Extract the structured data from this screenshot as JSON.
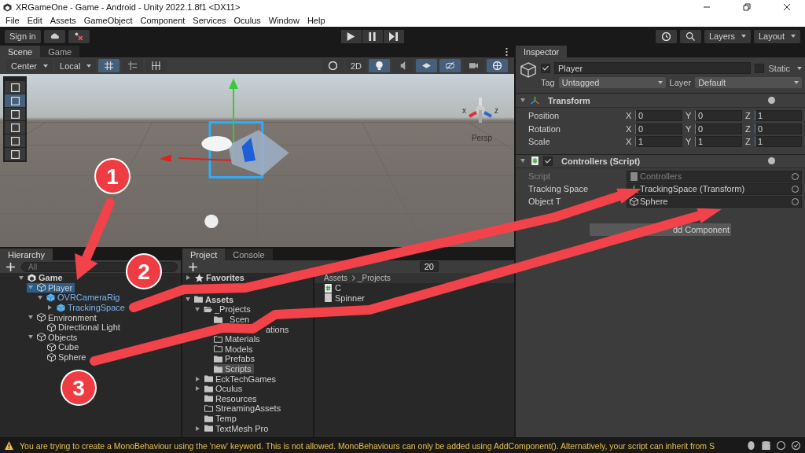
{
  "window": {
    "title": "XRGameOne - Game - Android - Unity 2022.1.8f1 <DX11>"
  },
  "menu": [
    "File",
    "Edit",
    "Assets",
    "GameObject",
    "Component",
    "Services",
    "Oculus",
    "Window",
    "Help"
  ],
  "toolbar": {
    "sign_in": "Sign in",
    "layers": "Layers",
    "layout": "Layout"
  },
  "scene_panel": {
    "tabs": [
      {
        "label": "Scene",
        "selected": true
      },
      {
        "label": "Game",
        "selected": false
      }
    ],
    "pivot": "Center",
    "space": "Local",
    "mode_2d": {
      "label": "2D",
      "selected": false
    },
    "lighting": {
      "selected": true
    },
    "gizmos": {
      "selected": true
    },
    "gizmo_labels": [
      "x",
      "z"
    ],
    "projection": "Persp"
  },
  "hierarchy": {
    "title": "Hierarchy",
    "search_placeholder": "All",
    "items": [
      {
        "label": "Game",
        "kind": "scene",
        "expanded": true,
        "selected": false,
        "children": [
          {
            "label": "Player",
            "kind": "object",
            "expanded": true,
            "selected": true,
            "children": [
              {
                "label": "OVRCameraRig",
                "kind": "prefab",
                "expanded": true,
                "selected": false,
                "children": [
                  {
                    "label": "TrackingSpace",
                    "kind": "prefab",
                    "expanded": false,
                    "selected": false
                  }
                ]
              }
            ]
          },
          {
            "label": "Environment",
            "kind": "object",
            "expanded": true,
            "selected": false,
            "children": [
              {
                "label": "Directional Light",
                "kind": "object",
                "selected": false
              }
            ]
          },
          {
            "label": "Objects",
            "kind": "object",
            "expanded": true,
            "selected": false,
            "children": [
              {
                "label": "Cube",
                "kind": "object",
                "selected": false
              },
              {
                "label": "Sphere",
                "kind": "object",
                "selected": false
              }
            ]
          }
        ]
      }
    ]
  },
  "project": {
    "tabs": [
      {
        "label": "Project",
        "selected": true
      },
      {
        "label": "Console",
        "selected": false
      }
    ],
    "count": "20",
    "tree": [
      {
        "label": "Favorites",
        "kind": "favorites",
        "expanded": false,
        "selected": false
      },
      {
        "label": "Assets",
        "kind": "root",
        "expanded": true,
        "selected": false,
        "children": [
          {
            "label": "_Projects",
            "kind": "open-folder",
            "expanded": true,
            "selected": false,
            "children": [
              {
                "label": "_Scen",
                "kind": "folder",
                "selected": false
              },
              {
                "label": "ations",
                "kind": "partial",
                "selected": false
              },
              {
                "label": "Materials",
                "kind": "empty-folder",
                "selected": false
              },
              {
                "label": "Models",
                "kind": "empty-folder",
                "selected": false
              },
              {
                "label": "Prefabs",
                "kind": "folder",
                "selected": false
              },
              {
                "label": "Scripts",
                "kind": "folder",
                "selected": true
              }
            ]
          },
          {
            "label": "EckTechGames",
            "kind": "folder",
            "expanded": false,
            "selected": false
          },
          {
            "label": "Oculus",
            "kind": "folder",
            "expanded": false,
            "selected": false
          },
          {
            "label": "Resources",
            "kind": "folder",
            "selected": false
          },
          {
            "label": "StreamingAssets",
            "kind": "empty-folder",
            "selected": false
          },
          {
            "label": "Temp",
            "kind": "folder",
            "selected": false
          },
          {
            "label": "TextMesh Pro",
            "kind": "folder",
            "expanded": false,
            "selected": false
          }
        ]
      }
    ],
    "breadcrumb": [
      "Assets",
      "_Projects"
    ],
    "files": [
      {
        "label": "C",
        "kind": "script"
      },
      {
        "label": "Spinner",
        "kind": "blank"
      }
    ]
  },
  "inspector": {
    "title": "Inspector",
    "object": {
      "name": "Player",
      "active": true,
      "static": false,
      "static_label": "Static",
      "tag_label": "Tag",
      "tag": "Untagged",
      "layer_label": "Layer",
      "layer": "Default"
    },
    "transform": {
      "title": "Transform",
      "rows": [
        {
          "label": "Position",
          "fields": [
            {
              "axis": "X",
              "value": "0"
            },
            {
              "axis": "Y",
              "value": "0"
            },
            {
              "axis": "Z",
              "value": "1"
            }
          ]
        },
        {
          "label": "Rotation",
          "fields": [
            {
              "axis": "X",
              "value": "0"
            },
            {
              "axis": "Y",
              "value": "0"
            },
            {
              "axis": "Z",
              "value": "0"
            }
          ]
        },
        {
          "label": "Scale",
          "fields": [
            {
              "axis": "X",
              "value": "1"
            },
            {
              "axis": "Y",
              "value": "1"
            },
            {
              "axis": "Z",
              "value": "1"
            }
          ]
        }
      ]
    },
    "script": {
      "title": "Controllers (Script)",
      "enabled": true,
      "fields": [
        {
          "label": "Script",
          "value": "Controllers",
          "kind": "script",
          "disabled": true
        },
        {
          "label": "Tracking Space",
          "value": "TrackingSpace (Transform)",
          "kind": "transform",
          "disabled": false
        },
        {
          "label": "Object T",
          "value": "Sphere",
          "kind": "object",
          "disabled": false
        }
      ]
    },
    "add_component": "dd Component"
  },
  "status_bar": {
    "message": "You are trying to create a MonoBehaviour using the 'new' keyword.  This is not allowed.  MonoBehaviours can only be added using AddComponent(). Alternatively, your script can inherit from S"
  },
  "annotations": [
    {
      "label": "1"
    },
    {
      "label": "2"
    },
    {
      "label": "3"
    }
  ]
}
